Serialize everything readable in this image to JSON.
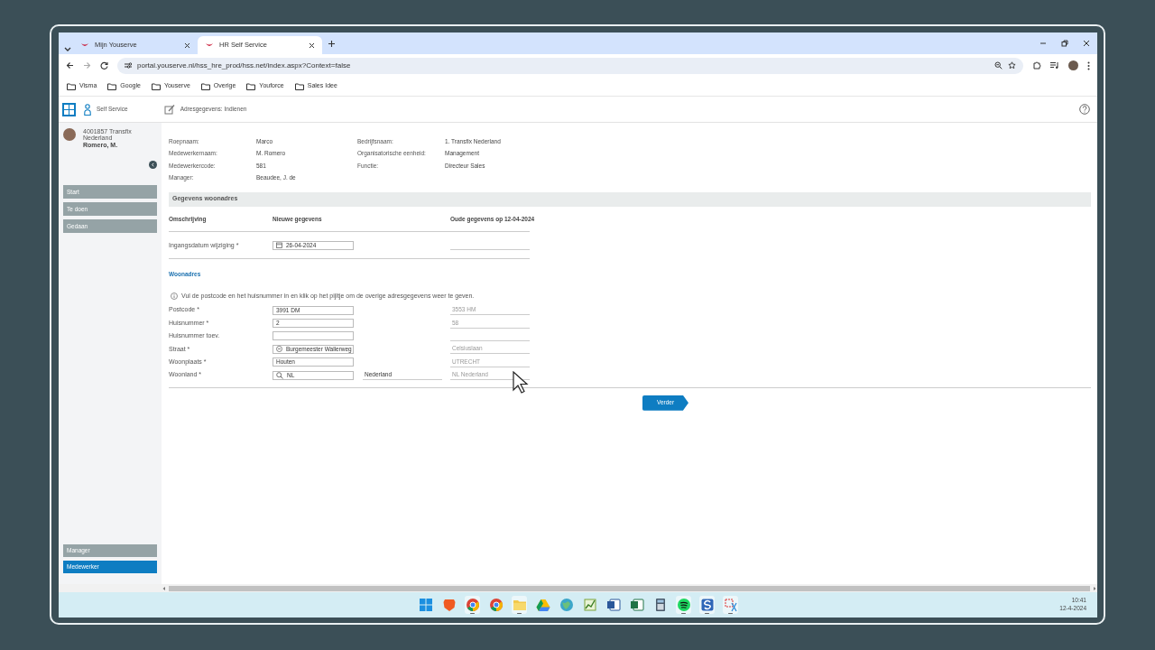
{
  "browser": {
    "tabs": [
      {
        "title": "Mijn Youserve",
        "selected": false
      },
      {
        "title": "HR Self Service",
        "selected": true
      }
    ],
    "url": "portal.youserve.nl/hss_hre_prod/hss.net/index.aspx?Context=false",
    "bookmarks": [
      "Visma",
      "Google",
      "Youserve",
      "Overige",
      "Youforce",
      "Sales Idee"
    ]
  },
  "app_header": {
    "section": "Self Service",
    "page": "Adresgegevens: Indienen"
  },
  "user": {
    "code": "4001857 Transfix Nederland",
    "name": "Romero, M."
  },
  "nav": [
    {
      "label": "Start",
      "selected": false
    },
    {
      "label": "Te doen",
      "selected": false
    },
    {
      "label": "Gedaan",
      "selected": false
    }
  ],
  "roles": [
    {
      "label": "Manager",
      "selected": false
    },
    {
      "label": "Medewerker",
      "selected": true
    }
  ],
  "info": [
    {
      "label": "Roepnaam:",
      "value": "Marco"
    },
    {
      "label": "Bedrijfsnaam:",
      "value": "1. Transfix Nederland"
    },
    {
      "label": "Medewerkernaam:",
      "value": "M. Romero"
    },
    {
      "label": "Organisatorische eenheid:",
      "value": "Management"
    },
    {
      "label": "Medewerkercode:",
      "value": "581"
    },
    {
      "label": "Functie:",
      "value": "Directeur Sales"
    },
    {
      "label": "Manager:",
      "value": "Beaudee, J. de"
    }
  ],
  "section_title": "Gegevens woonadres",
  "columns": [
    "Omschrijving",
    "Nieuwe gegevens",
    "Oude gegevens op 12-04-2024"
  ],
  "date_field": {
    "label": "Ingangsdatum wijziging *",
    "value": "26-04-2024"
  },
  "subsection": "Woonadres",
  "hint": "Vul de postcode en het huisnummer in en klik op het pijltje om de overige adresgegevens weer te geven.",
  "fields": [
    {
      "label": "Postcode *",
      "kind": "text",
      "value": "3991 DM",
      "old": "3553 HM"
    },
    {
      "label": "Huisnummer *",
      "kind": "text",
      "value": "2",
      "old": "58"
    },
    {
      "label": "Huisnummer toev.",
      "kind": "text"
    },
    {
      "label": "Straat *",
      "kind": "select",
      "value": "Burgemeester Wallerweg",
      "old": "Celsiuslaan"
    },
    {
      "label": "Woonplaats *",
      "kind": "text",
      "value": "Houten",
      "old": "UTRECHT"
    },
    {
      "label": "Woonland *",
      "kind": "search",
      "value": "NL",
      "extra": "Nederland",
      "old": "NL Nederland"
    }
  ],
  "button": "Verder",
  "taskbar": [
    {
      "kind": "start",
      "open": false
    },
    {
      "kind": "shield",
      "open": false
    },
    {
      "kind": "browser",
      "open": true
    },
    {
      "kind": "browser",
      "open": false
    },
    {
      "kind": "folder",
      "open": true
    },
    {
      "kind": "triangle",
      "open": false
    },
    {
      "kind": "globe",
      "open": false
    },
    {
      "kind": "chart",
      "open": false
    },
    {
      "kind": "document",
      "open": false
    },
    {
      "kind": "spreadsheet",
      "open": false
    },
    {
      "kind": "calculator",
      "open": false
    },
    {
      "kind": "music",
      "open": true
    },
    {
      "kind": "app",
      "open": true
    },
    {
      "kind": "scissors",
      "open": true
    }
  ],
  "clock": {
    "time": "10:41",
    "date": "12-4-2024"
  }
}
